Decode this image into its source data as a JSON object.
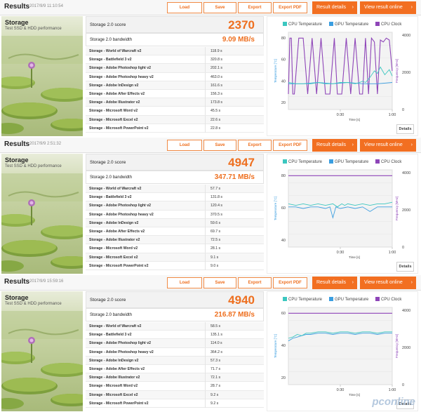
{
  "buttons": {
    "load": "Load",
    "save": "Save",
    "export": "Export",
    "export_pdf": "Export PDF",
    "result_details": "Result details",
    "view_online": "View result online",
    "details": "Details"
  },
  "header_title": "Results",
  "test_title": "Storage",
  "test_subtitle": "Test SSD & HDD performance",
  "score_label": "Storage 2.0 score",
  "bandwidth_label": "Storage 2.0 bandwidth",
  "legend": {
    "cpu_temp": "CPU Temperature",
    "gpu_temp": "GPU Temperature",
    "cpu_clock": "CPU Clock"
  },
  "axis": {
    "left_label": "Temperature [°C]",
    "right_label": "Frequency [MHz]",
    "x_label": "Time [s]",
    "x_ticks": [
      "0:30",
      "1:00"
    ]
  },
  "colors": {
    "accent": "#f26f21",
    "cpu_temp": "#3cc7c0",
    "gpu_temp": "#3b9ee0",
    "cpu_clock": "#8e45b8"
  },
  "watermark": "pconline",
  "results": [
    {
      "timestamp": "2017/9/9 11:10:54",
      "score": "2370",
      "bandwidth": "9.09 MB/s",
      "tests": [
        {
          "name": "Storage - World of Warcraft v2",
          "value": "118.9 s"
        },
        {
          "name": "Storage - Battlefield 3 v2",
          "value": "320.8 s"
        },
        {
          "name": "Storage - Adobe Photoshop light v2",
          "value": "202.1 s"
        },
        {
          "name": "Storage - Adobe Photoshop heavy v2",
          "value": "463.0 s"
        },
        {
          "name": "Storage - Adobe InDesign v2",
          "value": "161.6 s"
        },
        {
          "name": "Storage - Adobe After Effects v2",
          "value": "156.3 s"
        },
        {
          "name": "Storage - Adobe Illustrator v2",
          "value": "173.8 s"
        },
        {
          "name": "Storage - Microsoft Word v2",
          "value": "45.5 s"
        },
        {
          "name": "Storage - Microsoft Excel v2",
          "value": "22.6 s"
        },
        {
          "name": "Storage - Microsoft PowerPoint v2",
          "value": "22.8 s"
        }
      ],
      "chart_data": {
        "type": "line",
        "left_ticks": [
          "80",
          "60",
          "40",
          "20"
        ],
        "right_ticks": [
          "4000",
          "2000",
          "0"
        ],
        "ylim_left": [
          20,
          80
        ],
        "ylim_right": [
          0,
          4000
        ],
        "xlim": [
          0,
          70
        ],
        "series": [
          {
            "name": "CPU Temperature",
            "axis": "left",
            "x": [
              0,
              5,
              10,
              15,
              20,
              25,
              30,
              35,
              40,
              45,
              48,
              50,
              52,
              55,
              58,
              60,
              62,
              65,
              68,
              70
            ],
            "y": [
              41,
              40,
              40,
              40,
              41,
              40,
              40,
              41,
              41,
              40,
              41,
              42,
              41,
              45,
              50,
              48,
              53,
              47,
              51,
              46
            ]
          },
          {
            "name": "GPU Temperature",
            "axis": "left",
            "x": [
              0,
              10,
              20,
              30,
              40,
              50,
              60,
              70
            ],
            "y": [
              40,
              40,
              41,
              40,
              41,
              40,
              40,
              41
            ]
          },
          {
            "name": "CPU Clock",
            "axis": "right",
            "x": [
              0,
              1,
              2,
              3,
              4,
              7,
              10,
              13,
              16,
              19,
              22,
              25,
              28,
              31,
              33,
              36,
              39,
              42,
              45,
              48,
              50,
              52,
              54,
              56,
              58,
              60,
              62,
              64,
              66,
              68,
              70
            ],
            "y": [
              800,
              3700,
              3700,
              800,
              800,
              3700,
              3700,
              800,
              3700,
              800,
              3700,
              800,
              800,
              3700,
              800,
              800,
              3700,
              800,
              3700,
              800,
              800,
              3700,
              800,
              3700,
              3500,
              800,
              3600,
              3500,
              3700,
              3600,
              2000
            ]
          }
        ]
      }
    },
    {
      "timestamp": "2017/9/9 2:51:32",
      "score": "4947",
      "bandwidth": "347.71 MB/s",
      "tests": [
        {
          "name": "Storage - World of Warcraft v2",
          "value": "57.7 s"
        },
        {
          "name": "Storage - Battlefield 3 v2",
          "value": "131.8 s"
        },
        {
          "name": "Storage - Adobe Photoshop light v2",
          "value": "120.4 s"
        },
        {
          "name": "Storage - Adobe Photoshop heavy v2",
          "value": "370.5 s"
        },
        {
          "name": "Storage - Adobe InDesign v2",
          "value": "59.6 s"
        },
        {
          "name": "Storage - Adobe After Effects v2",
          "value": "69.7 s"
        },
        {
          "name": "Storage - Adobe Illustrator v2",
          "value": "72.5 s"
        },
        {
          "name": "Storage - Microsoft Word v2",
          "value": "28.1 s"
        },
        {
          "name": "Storage - Microsoft Excel v2",
          "value": "9.1 s"
        },
        {
          "name": "Storage - Microsoft PowerPoint v2",
          "value": "9.0 s"
        }
      ],
      "chart_data": {
        "type": "line",
        "left_ticks": [
          "80",
          "60",
          "40"
        ],
        "right_ticks": [
          "4000",
          "2000",
          "0"
        ],
        "ylim_left": [
          30,
          80
        ],
        "ylim_right": [
          0,
          4000
        ],
        "xlim": [
          0,
          70
        ],
        "series": [
          {
            "name": "CPU Temperature",
            "axis": "left",
            "x": [
              0,
              5,
              10,
              15,
              20,
              25,
              30,
              33,
              36,
              38,
              40,
              45,
              50,
              55,
              60,
              65,
              70
            ],
            "y": [
              58,
              57,
              58,
              57,
              58,
              57,
              58,
              56,
              58,
              57,
              58,
              57,
              58,
              57,
              58,
              58,
              59
            ]
          },
          {
            "name": "GPU Temperature",
            "axis": "left",
            "x": [
              0,
              5,
              10,
              15,
              20,
              25,
              28,
              30,
              32,
              35,
              40,
              45,
              50,
              55,
              60,
              65,
              70
            ],
            "y": [
              56,
              56,
              55,
              56,
              56,
              55,
              56,
              49,
              56,
              55,
              56,
              55,
              56,
              53,
              56,
              56,
              56
            ]
          },
          {
            "name": "CPU Clock",
            "axis": "right",
            "x": [
              0,
              70
            ],
            "y": [
              3700,
              3700
            ]
          }
        ]
      }
    },
    {
      "timestamp": "2017/9/9 15:59:16",
      "score": "4940",
      "bandwidth": "216.87 MB/s",
      "tests": [
        {
          "name": "Storage - World of Warcraft v2",
          "value": "58.5 s"
        },
        {
          "name": "Storage - Battlefield 3 v2",
          "value": "135.1 s"
        },
        {
          "name": "Storage - Adobe Photoshop light v2",
          "value": "114.0 s"
        },
        {
          "name": "Storage - Adobe Photoshop heavy v2",
          "value": "364.2 s"
        },
        {
          "name": "Storage - Adobe InDesign v2",
          "value": "57.3 s"
        },
        {
          "name": "Storage - Adobe After Effects v2",
          "value": "71.7 s"
        },
        {
          "name": "Storage - Adobe Illustrator v2",
          "value": "72.1 s"
        },
        {
          "name": "Storage - Microsoft Word v2",
          "value": "28.7 s"
        },
        {
          "name": "Storage - Microsoft Excel v2",
          "value": "9.2 s"
        },
        {
          "name": "Storage - Microsoft PowerPoint v2",
          "value": "9.2 s"
        }
      ],
      "chart_data": {
        "type": "line",
        "left_ticks": [
          "60",
          "40",
          "20"
        ],
        "right_ticks": [
          "4000",
          "2000",
          "0"
        ],
        "ylim_left": [
          10,
          70
        ],
        "ylim_right": [
          0,
          4000
        ],
        "xlim": [
          0,
          70
        ],
        "series": [
          {
            "name": "CPU Temperature",
            "axis": "left",
            "x": [
              0,
              3,
              6,
              9,
              12,
              15,
              20,
              25,
              30,
              35,
              40,
              45,
              50,
              55,
              60,
              65,
              70
            ],
            "y": [
              46,
              47,
              49,
              48,
              50,
              50,
              51,
              51,
              50,
              51,
              51,
              50,
              51,
              51,
              50,
              51,
              51
            ]
          },
          {
            "name": "GPU Temperature",
            "axis": "left",
            "x": [
              0,
              3,
              6,
              9,
              12,
              15,
              20,
              25,
              30,
              35,
              40,
              45,
              50,
              55,
              60,
              65,
              70
            ],
            "y": [
              44,
              46,
              47,
              48,
              49,
              49,
              50,
              50,
              49,
              50,
              50,
              49,
              50,
              50,
              49,
              50,
              50
            ]
          },
          {
            "name": "CPU Clock",
            "axis": "right",
            "x": [
              0,
              70
            ],
            "y": [
              3700,
              3700
            ]
          }
        ]
      }
    }
  ]
}
